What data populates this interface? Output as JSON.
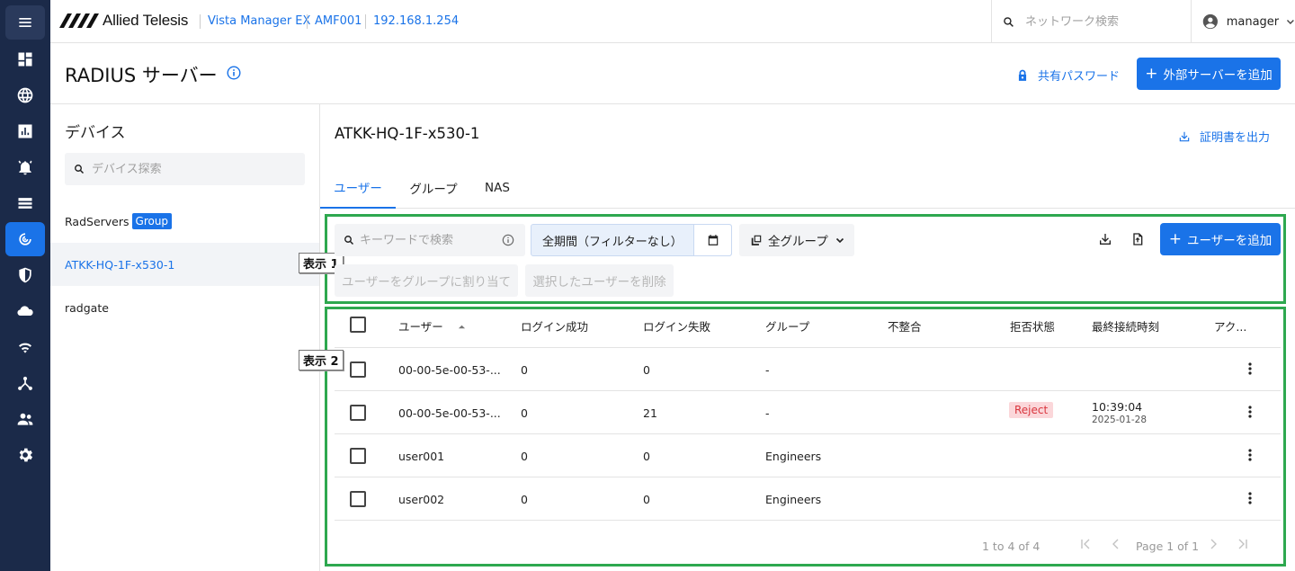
{
  "topbar": {
    "brand": "Allied Telesis",
    "app_name": "Vista Manager EX",
    "area": "AMF001",
    "ip": "192.168.1.254",
    "search_placeholder": "ネットワーク検索",
    "user": "manager"
  },
  "sidebar": {
    "items": [
      {
        "icon": "menu-icon"
      },
      {
        "icon": "dashboard-icon"
      },
      {
        "icon": "globe-icon"
      },
      {
        "icon": "bar-chart-icon"
      },
      {
        "icon": "alarm-icon"
      },
      {
        "icon": "list-icon"
      },
      {
        "icon": "radius-icon",
        "active": true
      },
      {
        "icon": "shield-icon"
      },
      {
        "icon": "cloud-icon"
      },
      {
        "icon": "wifi-icon"
      },
      {
        "icon": "topology-icon"
      },
      {
        "icon": "users-icon"
      },
      {
        "icon": "settings-icon"
      }
    ]
  },
  "header": {
    "title": "RADIUS サーバー",
    "shared_password": "共有パスワード",
    "add_external": "外部サーバーを追加"
  },
  "devices": {
    "title": "デバイス",
    "search_placeholder": "デバイス探索",
    "items": [
      {
        "name": "RadServers",
        "badge": "Group"
      },
      {
        "name": "ATKK-HQ-1F-x530-1",
        "selected": true
      },
      {
        "name": "radgate"
      }
    ]
  },
  "detail": {
    "title": "ATKK-HQ-1F-x530-1",
    "export_cert": "証明書を出力",
    "tabs": [
      "ユーザー",
      "グループ",
      "NAS"
    ]
  },
  "callouts": {
    "one": "表示 1",
    "two": "表示 2"
  },
  "toolbar": {
    "keyword_placeholder": "キーワードで検索",
    "period": "全期間（フィルターなし）",
    "group_filter": "全グループ",
    "add_user": "ユーザーを追加",
    "assign_group": "ユーザーをグループに割り当て",
    "delete_selected": "選択したユーザーを削除"
  },
  "table": {
    "columns": [
      "ユーザー",
      "ログイン成功",
      "ログイン失敗",
      "グループ",
      "不整合",
      "拒否状態",
      "最終接続時刻",
      "アク..."
    ],
    "rows": [
      {
        "user": "00-00-5e-00-53-...",
        "success": "0",
        "fail": "0",
        "group": "-",
        "mismatch": "",
        "reject": "",
        "last_time": "",
        "last_date": ""
      },
      {
        "user": "00-00-5e-00-53-...",
        "success": "0",
        "fail": "21",
        "group": "-",
        "mismatch": "",
        "reject": "Reject",
        "last_time": "10:39:04",
        "last_date": "2025-01-28"
      },
      {
        "user": "user001",
        "success": "0",
        "fail": "0",
        "group": "Engineers",
        "mismatch": "",
        "reject": "",
        "last_time": "",
        "last_date": ""
      },
      {
        "user": "user002",
        "success": "0",
        "fail": "0",
        "group": "Engineers",
        "mismatch": "",
        "reject": "",
        "last_time": "",
        "last_date": ""
      }
    ],
    "range": "1 to 4 of 4",
    "page": "Page 1 of 1"
  },
  "colors": {
    "accent": "#1a73e8",
    "rail": "#1b2a49",
    "highlight": "#2ea84f",
    "reject_bg": "#fbd7da"
  }
}
